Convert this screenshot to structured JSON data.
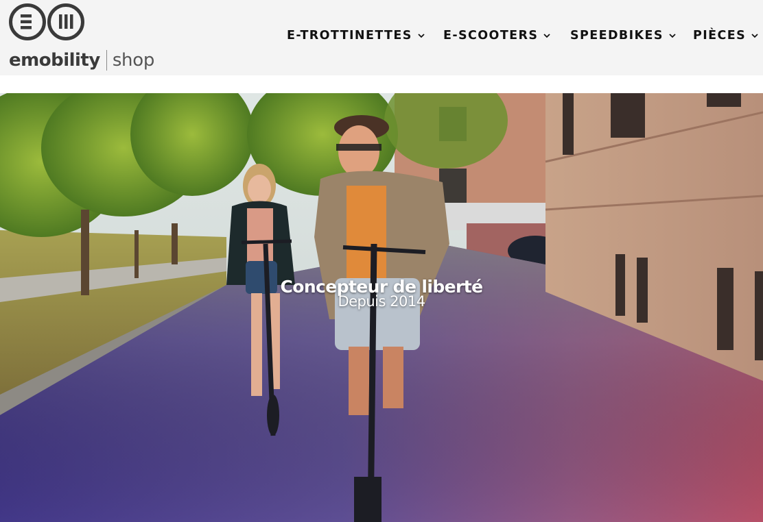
{
  "brand": {
    "logo_icon": "em-logo-icon",
    "name_main": "emobility",
    "name_sub": "shop"
  },
  "nav": {
    "items": [
      {
        "label": "E-TROTTINETTES",
        "icon": "chevron-down-icon"
      },
      {
        "label": "E-SCOOTERS",
        "icon": "chevron-down-icon"
      },
      {
        "label": "SPEEDBIKES",
        "icon": "chevron-down-icon"
      },
      {
        "label": "PIÈCES",
        "icon": "chevron-down-icon"
      }
    ]
  },
  "hero": {
    "title": "Concepteur de liberté",
    "subtitle": "Depuis 2014",
    "image": "photo: couple riding electric scooters on a city street"
  },
  "colors": {
    "header_bg": "#f4f4f4",
    "text_dark": "#111111",
    "logo_dark": "#3a3a3a",
    "gradient_purple": "#3a2b8a",
    "gradient_pink": "#c0456a"
  }
}
